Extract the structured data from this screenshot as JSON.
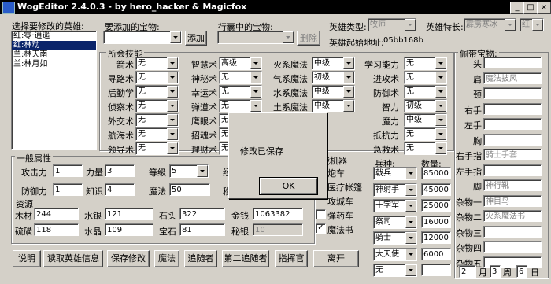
{
  "window": {
    "title": "WogEditor 2.4.0.3 - by  hero_hacker  &  Magicfox",
    "min": "_",
    "max": "□",
    "close": "×"
  },
  "hero_select": {
    "label": "选择要修改的英雄:",
    "items": [
      "红:零·逍遥",
      "红:林动",
      "兰:林天南",
      "兰:林月如"
    ],
    "selected": 1
  },
  "add_item": {
    "label": "要添加的宝物:",
    "value": "",
    "button": "添加"
  },
  "backpack": {
    "label": "行囊中的宝物:",
    "value": "",
    "button": "删除"
  },
  "hero_type": {
    "label": "英雄类型:",
    "value": "牧师"
  },
  "hero_special": {
    "label": "英雄特长:",
    "value": "霹雳寒冰",
    "color": "红"
  },
  "hero_address": {
    "label": "英雄起始地址:",
    "value": "05bb168b"
  },
  "skills": {
    "title": "所会技能",
    "rows": [
      [
        {
          "name": "箭术",
          "value": "无"
        },
        {
          "name": "智慧术",
          "value": "高级"
        },
        {
          "name": "火系魔法",
          "value": "中级"
        },
        {
          "name": "学习能力",
          "value": "无"
        }
      ],
      [
        {
          "name": "寻路术",
          "value": "无"
        },
        {
          "name": "神秘术",
          "value": "无"
        },
        {
          "name": "气系魔法",
          "value": "初级"
        },
        {
          "name": "进攻术",
          "value": "无"
        }
      ],
      [
        {
          "name": "后勤学",
          "value": "无"
        },
        {
          "name": "幸运术",
          "value": "无"
        },
        {
          "name": "水系魔法",
          "value": "中级"
        },
        {
          "name": "防御术",
          "value": "无"
        }
      ],
      [
        {
          "name": "侦察术",
          "value": "无"
        },
        {
          "name": "弹道术",
          "value": "无"
        },
        {
          "name": "土系魔法",
          "value": "中级"
        },
        {
          "name": "智力",
          "value": "初级"
        }
      ],
      [
        {
          "name": "外交术",
          "value": "无"
        },
        {
          "name": "鹰眼术",
          "value": "无"
        },
        {
          "name": "",
          "value": ""
        },
        {
          "name": "魔力",
          "value": "中级"
        }
      ],
      [
        {
          "name": "航海术",
          "value": "无"
        },
        {
          "name": "招魂术",
          "value": "无"
        },
        {
          "name": "",
          "value": ""
        },
        {
          "name": "抵抗力",
          "value": "无"
        }
      ],
      [
        {
          "name": "领导术",
          "value": "无"
        },
        {
          "name": "理财术",
          "value": "无"
        },
        {
          "name": "",
          "value": ""
        },
        {
          "name": "急救术",
          "value": "无"
        }
      ]
    ]
  },
  "attributes": {
    "title": "一般属性",
    "attack": {
      "label": "攻击力",
      "value": "1"
    },
    "power": {
      "label": "力量",
      "value": "3"
    },
    "level": {
      "label": "等级",
      "value": "5"
    },
    "experience_label": "经",
    "defense": {
      "label": "防御力",
      "value": "1"
    },
    "knowledge": {
      "label": "知识",
      "value": "4"
    },
    "mana": {
      "label": "魔法",
      "value": "50"
    },
    "movement_label": "移"
  },
  "resources": {
    "title": "资源",
    "wood": {
      "label": "木材",
      "value": "244"
    },
    "mercury": {
      "label": "水银",
      "value": "121"
    },
    "ore": {
      "label": "石头",
      "value": "322"
    },
    "gold": {
      "label": "金钱",
      "value": "1063382"
    },
    "sulfur": {
      "label": "硫磺",
      "value": "118"
    },
    "crystal": {
      "label": "水晶",
      "value": "109"
    },
    "gems": {
      "label": "宝石",
      "value": "81"
    },
    "secret": {
      "label": "秘银",
      "value": "10"
    }
  },
  "war_machines": {
    "title": "战机器",
    "items": [
      {
        "label": "炮车",
        "checked": false,
        "visible_check": false
      },
      {
        "label": "医疗帐篷",
        "checked": false,
        "visible_check": false
      },
      {
        "label": "攻城车",
        "checked": false,
        "visible_check": false
      },
      {
        "label": "弹药车",
        "checked": false,
        "visible_check": true
      },
      {
        "label": "魔法书",
        "checked": true,
        "visible_check": true
      }
    ]
  },
  "troops": {
    "type_label": "兵种:",
    "count_label": "数量:",
    "rows": [
      {
        "type": "戟兵",
        "count": "85000"
      },
      {
        "type": "神射手",
        "count": "45000"
      },
      {
        "type": "十字军",
        "count": "25000"
      },
      {
        "type": "祭司",
        "count": "16000"
      },
      {
        "type": "骑士",
        "count": "12000"
      },
      {
        "type": "大天使",
        "count": "6000"
      },
      {
        "type": "无",
        "count": ""
      }
    ]
  },
  "equipment": {
    "title": "佩带宝物:",
    "slots": [
      {
        "label": "头",
        "value": ""
      },
      {
        "label": "肩",
        "value": "魔法披风"
      },
      {
        "label": "颈",
        "value": ""
      },
      {
        "label": "右手",
        "value": ""
      },
      {
        "label": "左手",
        "value": ""
      },
      {
        "label": "胸",
        "value": ""
      },
      {
        "label": "右手指",
        "value": "骑士手套"
      },
      {
        "label": "左手指",
        "value": ""
      },
      {
        "label": "脚",
        "value": "神行靴"
      },
      {
        "label": "杂物一",
        "value": "神目鸟"
      },
      {
        "label": "杂物二",
        "value": "火系魔法书"
      },
      {
        "label": "杂物三",
        "value": ""
      },
      {
        "label": "杂物四",
        "value": ""
      },
      {
        "label": "杂物五",
        "value": ""
      }
    ]
  },
  "date": {
    "month": "2",
    "month_label": "月",
    "week": "3",
    "week_label": "周",
    "day": "6",
    "day_label": "日"
  },
  "bottom_buttons": [
    "说明",
    "读取英雄信息",
    "保存修改",
    "魔法",
    "追随者",
    "第二追随者",
    "指挥官",
    "离开"
  ],
  "dialog": {
    "message": "修改已保存",
    "ok": "OK"
  }
}
